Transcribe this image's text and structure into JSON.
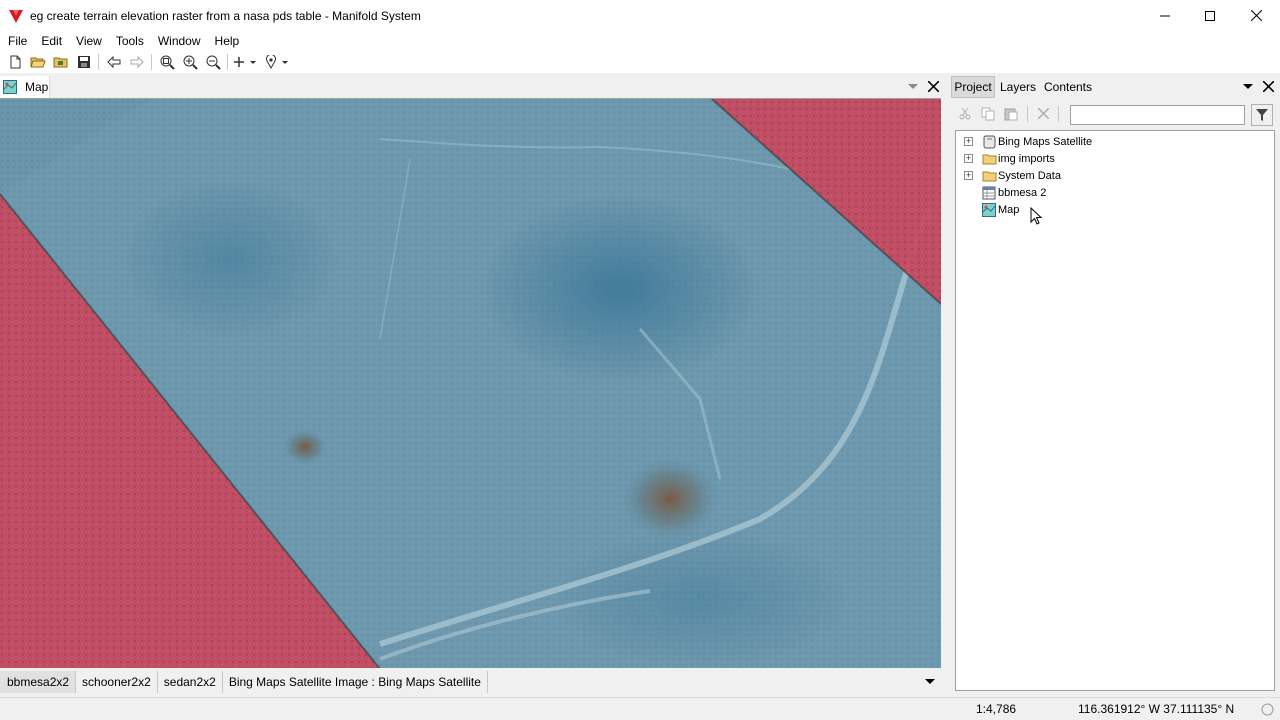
{
  "window": {
    "title": "eg create terrain elevation raster from a nasa pds table - Manifold System"
  },
  "menu": [
    "File",
    "Edit",
    "View",
    "Tools",
    "Window",
    "Help"
  ],
  "document_tab": {
    "label": "Map"
  },
  "map_layer_tabs": [
    "bbmesa2x2",
    "schooner2x2",
    "sedan2x2",
    "Bing Maps Satellite Image : Bing Maps Satellite"
  ],
  "panel": {
    "tabs": [
      "Project",
      "Layers",
      "Contents"
    ],
    "active_tab": "Project",
    "search_value": "",
    "tree": [
      {
        "label": "Bing Maps Satellite",
        "icon": "data-source-icon",
        "expandable": true
      },
      {
        "label": "img imports",
        "icon": "folder-icon",
        "expandable": true
      },
      {
        "label": "System Data",
        "icon": "folder-icon",
        "expandable": true
      },
      {
        "label": "bbmesa 2",
        "icon": "table-icon",
        "expandable": false
      },
      {
        "label": "Map",
        "icon": "map-icon",
        "expandable": false
      }
    ]
  },
  "status": {
    "scale": "1:4,786",
    "coordinates": "116.361912° W 37.111135° N"
  },
  "colors": {
    "overlay_red": "#c8485e",
    "imagery_blue": "#5f8ea6"
  }
}
